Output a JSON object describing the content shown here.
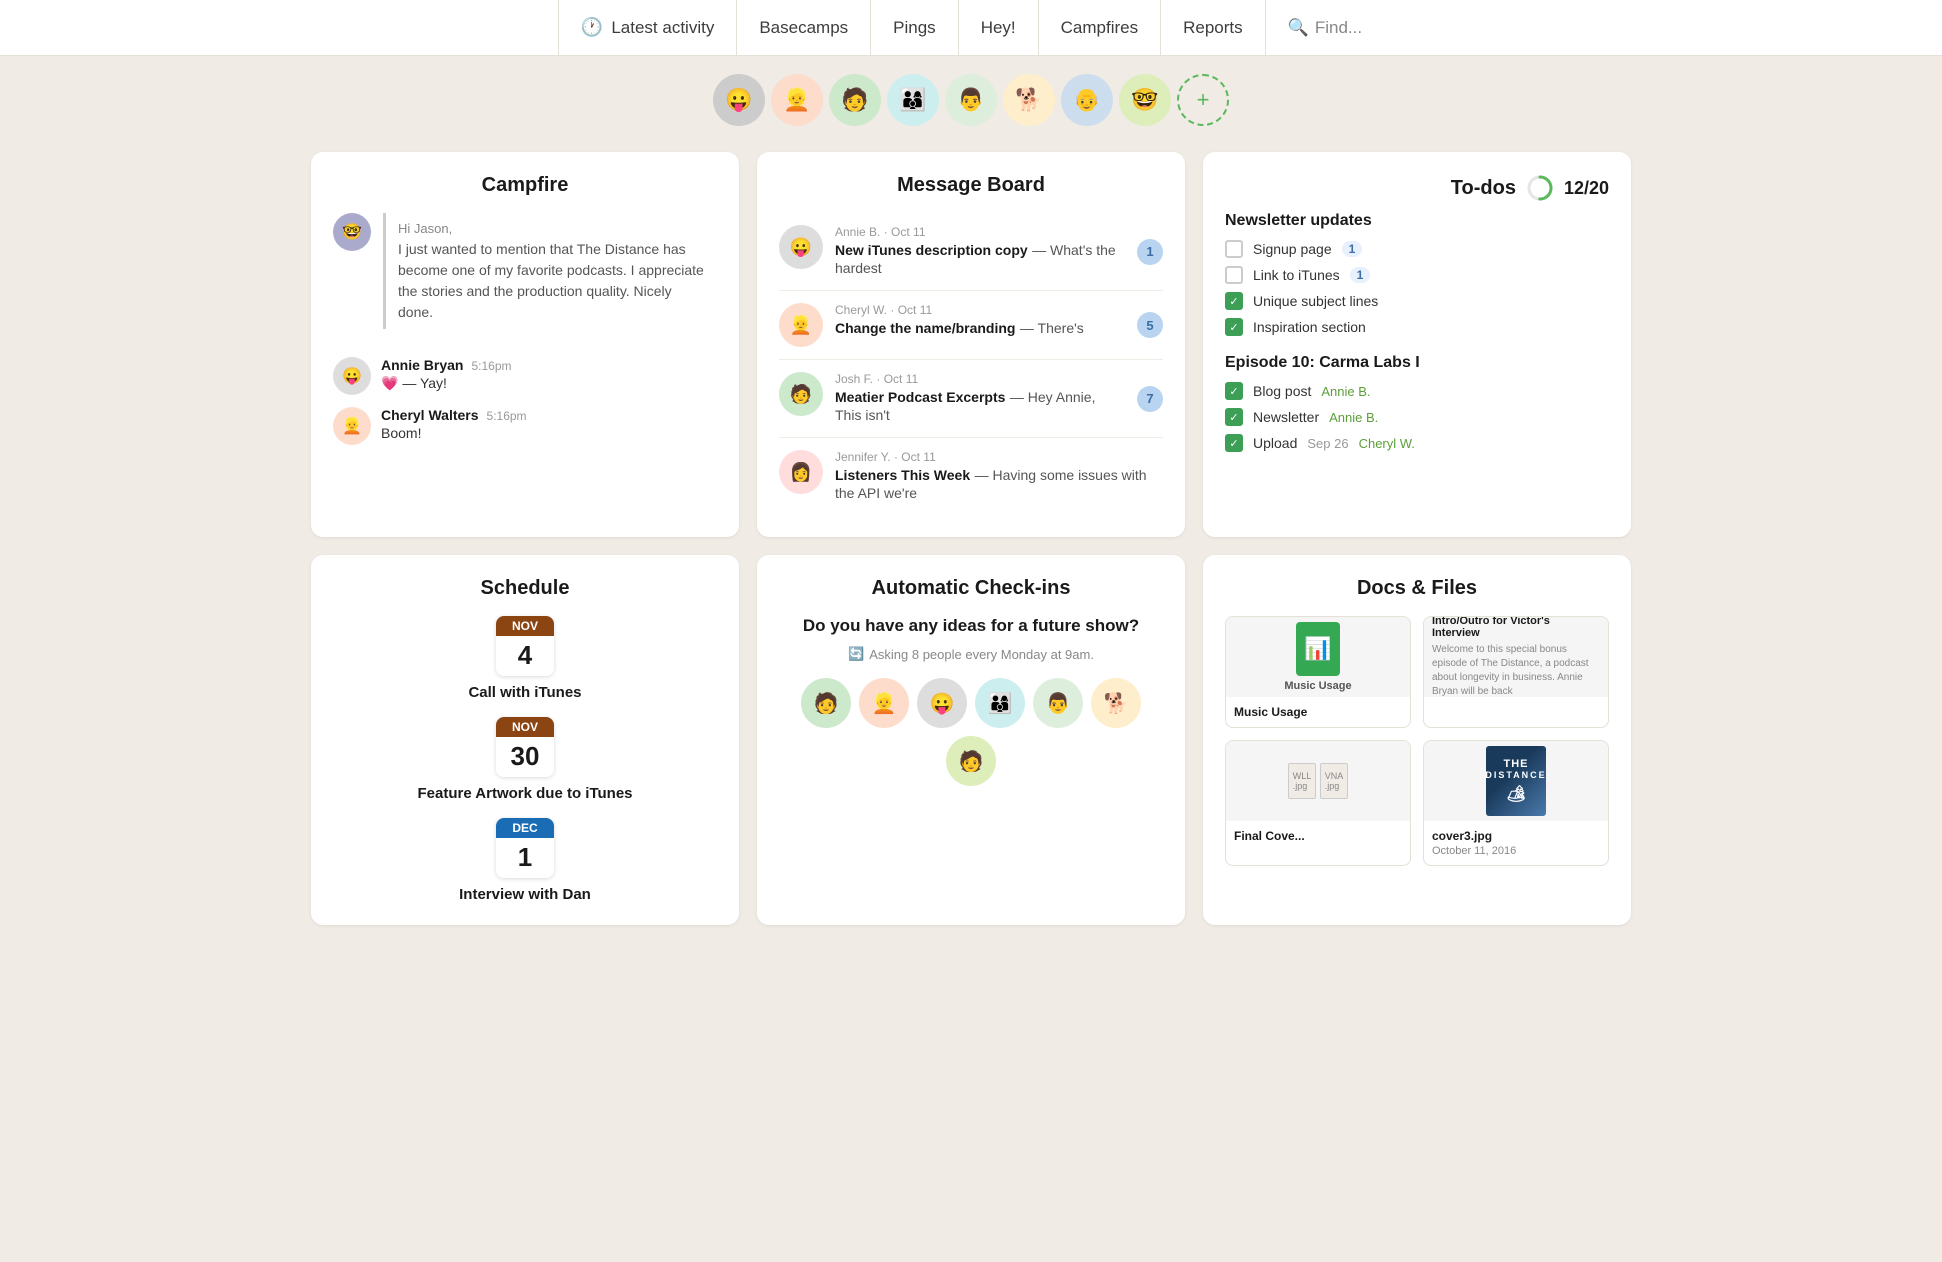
{
  "nav": {
    "items": [
      {
        "label": "Latest activity",
        "icon": "clock",
        "active": true
      },
      {
        "label": "Basecamps",
        "active": false
      },
      {
        "label": "Pings",
        "active": false
      },
      {
        "label": "Hey!",
        "active": false
      },
      {
        "label": "Campfires",
        "active": false
      },
      {
        "label": "Reports",
        "active": false
      }
    ],
    "search_placeholder": "Find..."
  },
  "avatars": [
    {
      "emoji": "😛",
      "color": "#f9c"
    },
    {
      "emoji": "👱",
      "color": "#fdc"
    },
    {
      "emoji": "🧑",
      "color": "#c9e"
    },
    {
      "emoji": "👨‍👩‍👦",
      "color": "#cef"
    },
    {
      "emoji": "👨",
      "color": "#dce"
    },
    {
      "emoji": "🐕",
      "color": "#fec"
    },
    {
      "emoji": "👴",
      "color": "#ced"
    },
    {
      "emoji": "👓",
      "color": "#dec"
    }
  ],
  "campfire": {
    "title": "Campfire",
    "greeting": "Hi Jason,",
    "message": "I just wanted to mention that The Distance has become one of my favorite podcasts. I appreciate the stories and the production quality. Nicely done.",
    "replies": [
      {
        "name": "Annie Bryan",
        "time": "5:16pm",
        "text": "💗 — Yay!",
        "emoji": "😛"
      },
      {
        "name": "Cheryl Walters",
        "time": "5:16pm",
        "text": "Boom!",
        "emoji": "👱"
      }
    ]
  },
  "message_board": {
    "title": "Message Board",
    "messages": [
      {
        "author": "Annie B.",
        "date": "Oct 11",
        "title": "New iTunes description copy",
        "preview": "— What's the hardest",
        "badge": "1",
        "emoji": "😛"
      },
      {
        "author": "Cheryl W.",
        "date": "Oct 11",
        "title": "Change the name/branding",
        "preview": "— There's",
        "badge": "5",
        "emoji": "👱"
      },
      {
        "author": "Josh F.",
        "date": "Oct 11",
        "title": "Meatier Podcast Excerpts",
        "preview": "— Hey Annie, This isn't",
        "badge": "7",
        "emoji": "🧑"
      },
      {
        "author": "Jennifer Y.",
        "date": "Oct 11",
        "title": "Listeners This Week",
        "preview": "— Having some issues with the API we're",
        "badge": null,
        "emoji": "👩"
      }
    ]
  },
  "todos": {
    "title": "To-dos",
    "progress": "12/20",
    "sections": [
      {
        "title": "Newsletter updates",
        "items": [
          {
            "label": "Signup page",
            "checked": false,
            "badge": "1",
            "person": null,
            "date": null
          },
          {
            "label": "Link to iTunes",
            "checked": false,
            "badge": "1",
            "person": null,
            "date": null
          },
          {
            "label": "Unique subject lines",
            "checked": true,
            "badge": null,
            "person": null,
            "date": null
          },
          {
            "label": "Inspiration section",
            "checked": true,
            "badge": null,
            "person": null,
            "date": null
          }
        ]
      },
      {
        "title": "Episode 10: Carma Labs I",
        "items": [
          {
            "label": "Blog post",
            "checked": true,
            "badge": null,
            "person": "Annie B.",
            "date": null
          },
          {
            "label": "Newsletter",
            "checked": true,
            "badge": null,
            "person": "Annie B.",
            "date": null
          },
          {
            "label": "Upload",
            "checked": true,
            "badge": null,
            "person": "Cheryl W.",
            "date": "Sep 26"
          }
        ]
      }
    ]
  },
  "schedule": {
    "title": "Schedule",
    "items": [
      {
        "month": "Nov",
        "day": "4",
        "label": "Call with iTunes",
        "month_type": "nov"
      },
      {
        "month": "Nov",
        "day": "30",
        "label": "Feature Artwork due to iTunes",
        "month_type": "nov"
      },
      {
        "month": "Dec",
        "day": "1",
        "label": "Interview with Dan",
        "month_type": "dec"
      }
    ]
  },
  "checkins": {
    "title": "Automatic Check-ins",
    "question": "Do you have any ideas for a future show?",
    "meta": "Asking 8 people every Monday at 9am.",
    "avatar_emojis": [
      "🧑",
      "👱",
      "😛",
      "👨‍👩‍👦",
      "👨",
      "🐕"
    ]
  },
  "docs": {
    "title": "Docs & Files",
    "items": [
      {
        "title": "Music Usage",
        "type": "google-sheet",
        "desc": ""
      },
      {
        "title": "Intro/Outro for Victor's Interview",
        "type": "text",
        "desc": "Welcome to this special bonus episode of The Distance, a podcast about longevity in business. Annie Bryan will be back"
      },
      {
        "title": "Final Cove...",
        "type": "files",
        "desc": ""
      },
      {
        "title": "cover3.jpg",
        "type": "image",
        "desc": "October 11, 2016"
      }
    ]
  }
}
